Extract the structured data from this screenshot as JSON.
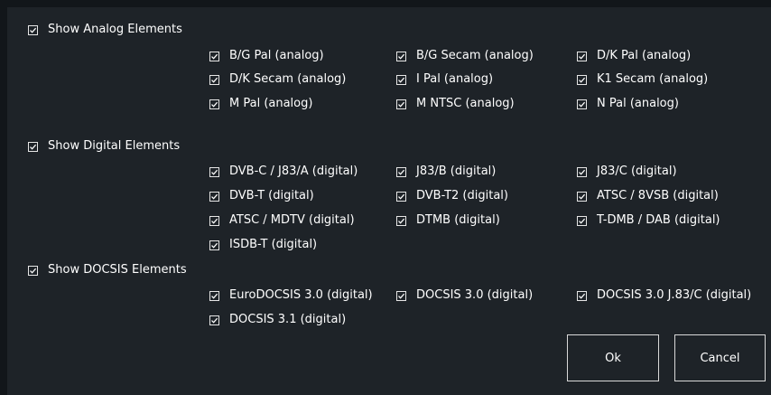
{
  "sections": [
    {
      "label": "Show Analog Elements",
      "checked": true,
      "items": [
        {
          "label": "B/G Pal (analog)",
          "checked": true
        },
        {
          "label": "B/G Secam (analog)",
          "checked": true
        },
        {
          "label": "D/K Pal (analog)",
          "checked": true
        },
        {
          "label": "D/K Secam (analog)",
          "checked": true
        },
        {
          "label": "I Pal (analog)",
          "checked": true
        },
        {
          "label": "K1 Secam (analog)",
          "checked": true
        },
        {
          "label": "M Pal (analog)",
          "checked": true
        },
        {
          "label": "M NTSC (analog)",
          "checked": true
        },
        {
          "label": "N Pal (analog)",
          "checked": true
        }
      ]
    },
    {
      "label": "Show Digital Elements",
      "checked": true,
      "items": [
        {
          "label": "DVB-C / J83/A (digital)",
          "checked": true
        },
        {
          "label": "J83/B (digital)",
          "checked": true
        },
        {
          "label": "J83/C (digital)",
          "checked": true
        },
        {
          "label": "DVB-T (digital)",
          "checked": true
        },
        {
          "label": "DVB-T2 (digital)",
          "checked": true
        },
        {
          "label": "ATSC / 8VSB (digital)",
          "checked": true
        },
        {
          "label": "ATSC / MDTV (digital)",
          "checked": true
        },
        {
          "label": "DTMB (digital)",
          "checked": true
        },
        {
          "label": "T-DMB / DAB (digital)",
          "checked": true
        },
        {
          "label": "ISDB-T (digital)",
          "checked": true
        }
      ]
    },
    {
      "label": "Show DOCSIS Elements",
      "checked": true,
      "items": [
        {
          "label": "EuroDOCSIS 3.0 (digital)",
          "checked": true
        },
        {
          "label": "DOCSIS 3.0 (digital)",
          "checked": true
        },
        {
          "label": "DOCSIS 3.0 J.83/C (digital)",
          "checked": true
        },
        {
          "label": "DOCSIS 3.1 (digital)",
          "checked": true
        }
      ]
    }
  ],
  "buttons": {
    "ok_label": "Ok",
    "cancel_label": "Cancel"
  }
}
